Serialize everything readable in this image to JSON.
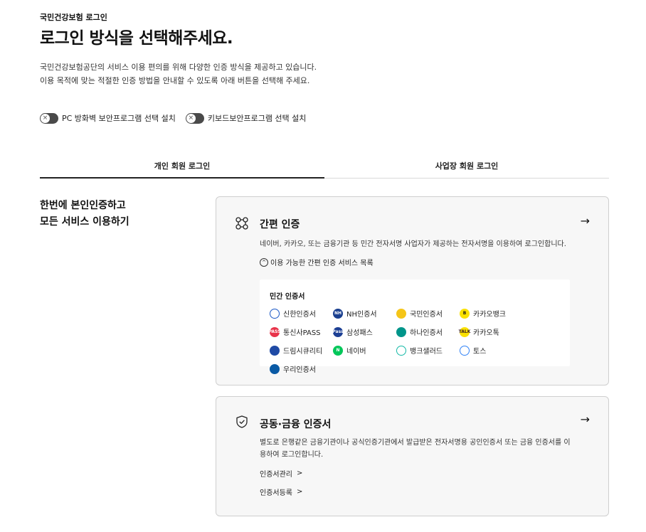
{
  "header": {
    "eyebrow": "국민건강보험 로그인",
    "title": "로그인 방식을 선택해주세요.",
    "desc_line1": "국민건강보험공단의 서비스 이용 편의를 위해 다양한 인증 방식을 제공하고 있습니다.",
    "desc_line2": "이용 목적에 맞는 적절한 인증 방법을 안내할 수 있도록 아래 버튼을 선택해 주세요."
  },
  "toggles": [
    {
      "label": "PC 방화벽 보안프로그램 선택 설치",
      "state": "off",
      "icon": "x-icon"
    },
    {
      "label": "키보드보안프로그램 선택 설치",
      "state": "off",
      "icon": "x-icon"
    }
  ],
  "tabs": [
    {
      "label": "개인 회원 로그인",
      "active": true
    },
    {
      "label": "사업장 회원 로그인",
      "active": false
    }
  ],
  "left_heading": {
    "line1": "한번에 본인인증하고",
    "line2": "모든 서비스 이용하기"
  },
  "simple_auth": {
    "title": "간편 인증",
    "arrow": "→",
    "desc": "네이버, 카카오, 또는 금융기관 등 민간 전자서명 사업자가 제공하는 전자서명을 이용하여 로그인합니다.",
    "toggle_symbol": "^",
    "toggle_label": "이용 가능한 간편 인증 서비스 목록",
    "box_title": "민간 인증서",
    "providers": [
      {
        "name": "신한인증서",
        "logo_text": "",
        "color": "#ffffff",
        "fg": "#1b58c6"
      },
      {
        "name": "NH인증서",
        "logo_text": "NH",
        "color": "#1a3f8f",
        "fg": "#ffffff"
      },
      {
        "name": "국민인증서",
        "logo_text": "",
        "color": "#f5c518",
        "fg": "#6b5a2a"
      },
      {
        "name": "카카오뱅크",
        "logo_text": "B",
        "color": "#fae100",
        "fg": "#1a1a1a"
      },
      {
        "name": "통신사PASS",
        "logo_text": "PASS",
        "color": "#e8334a",
        "fg": "#ffffff"
      },
      {
        "name": "삼성패스",
        "logo_text": "Pass",
        "color": "#1c3f94",
        "fg": "#ffffff"
      },
      {
        "name": "하나인증서",
        "logo_text": "",
        "color": "#00958a",
        "fg": "#ffffff"
      },
      {
        "name": "카카오톡",
        "logo_text": "TALK",
        "color": "#fae100",
        "fg": "#3c1e1e"
      },
      {
        "name": "드림시큐리티",
        "logo_text": "",
        "color": "#1f4aa5",
        "fg": "#ffffff"
      },
      {
        "name": "네이버",
        "logo_text": "N",
        "color": "#03c75a",
        "fg": "#ffffff"
      },
      {
        "name": "뱅크샐러드",
        "logo_text": "",
        "color": "#ffffff",
        "fg": "#14b8a6"
      },
      {
        "name": "토스",
        "logo_text": "",
        "color": "#ffffff",
        "fg": "#3182f6"
      },
      {
        "name": "우리인증서",
        "logo_text": "",
        "color": "#0a5aa5",
        "fg": "#ffffff"
      }
    ]
  },
  "public_cert": {
    "title": "공동·금융 인증서",
    "arrow": "→",
    "desc": "별도로 은행같은 금융기관이나 공식인증기관에서 발급받은 전자서명용 공인인증서 또는 금융 인증서를 이용하여 로그인합니다.",
    "links": [
      {
        "label": "인증서관리",
        "chev": ">"
      },
      {
        "label": "인증서등록",
        "chev": ">"
      }
    ]
  }
}
